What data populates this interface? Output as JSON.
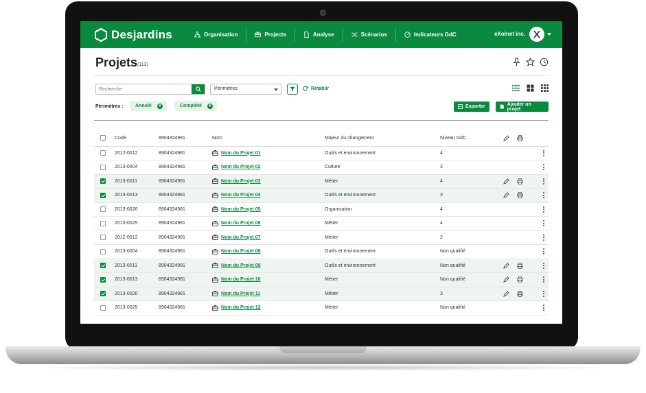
{
  "app": {
    "brand": "Desjardins",
    "nav": [
      {
        "label": "Organisation",
        "icon": "org-chart-icon"
      },
      {
        "label": "Projects",
        "icon": "briefcase-icon"
      },
      {
        "label": "Analyse",
        "icon": "document-icon"
      },
      {
        "label": "Scénarios",
        "icon": "shuffle-icon"
      },
      {
        "label": "Indicateurs GdC",
        "icon": "gauge-icon"
      }
    ],
    "user": "eXolnet inc.",
    "accent_color": "#0a8a3e"
  },
  "page": {
    "title": "Projets",
    "count": "(113)"
  },
  "filters": {
    "search_placeholder": "Recherche",
    "scope_select": "Périmètres",
    "reset_label": "Rétablir",
    "scope_label": "Périmètres :",
    "chips": [
      "Annulé",
      "Complété"
    ],
    "export_label": "Exporter",
    "add_label": "Ajouter un projet"
  },
  "table": {
    "headers": {
      "code": "Code",
      "number": "8904324981",
      "name": "Nom",
      "major": "Majeur du changement",
      "level": "Niveau GdC"
    },
    "rows": [
      {
        "checked": false,
        "code": "2012-0012",
        "number": "8904324981",
        "name": "Nom du Projet 01",
        "major": "Outils et environnement",
        "level": "4",
        "actions": false
      },
      {
        "checked": false,
        "code": "2013-0004",
        "number": "8904324981",
        "name": "Nom du Projet 02",
        "major": "Culture",
        "level": "3",
        "actions": false
      },
      {
        "checked": true,
        "code": "2013-0011",
        "number": "8904324981",
        "name": "Nom du Projet 03",
        "major": "Métier",
        "level": "4",
        "actions": true
      },
      {
        "checked": true,
        "code": "2013-0013",
        "number": "8904324981",
        "name": "Nom du Projet 04",
        "major": "Outils et environnement",
        "level": "3",
        "actions": true
      },
      {
        "checked": false,
        "code": "2013-0020",
        "number": "8904324981",
        "name": "Nom du Projet 05",
        "major": "Organisation",
        "level": "4",
        "actions": false
      },
      {
        "checked": false,
        "code": "2013-0025",
        "number": "8904324981",
        "name": "Nom du Projet 06",
        "major": "Métier",
        "level": "4",
        "actions": false
      },
      {
        "checked": false,
        "code": "2012-0012",
        "number": "8904324981",
        "name": "Nom du Projet 07",
        "major": "Métier",
        "level": "2",
        "actions": false
      },
      {
        "checked": false,
        "code": "2013-0004",
        "number": "8904324981",
        "name": "Nom du Projet 08",
        "major": "Outils et environnement",
        "level": "Non qualifié",
        "actions": false
      },
      {
        "checked": true,
        "code": "2013-0011",
        "number": "8904324981",
        "name": "Nom du Projet 09",
        "major": "Outils et environnement",
        "level": "Non qualifié",
        "actions": true
      },
      {
        "checked": true,
        "code": "2013-0013",
        "number": "8904324981",
        "name": "Nom du Projet 10",
        "major": "Métier",
        "level": "Non qualifié",
        "actions": true
      },
      {
        "checked": true,
        "code": "2013-0020",
        "number": "8904324981",
        "name": "Nom du Projet 11",
        "major": "Métier",
        "level": "3",
        "actions": true
      },
      {
        "checked": false,
        "code": "2013-0025",
        "number": "8904324981",
        "name": "Nom du Projet 12",
        "major": "Métier",
        "level": "Non qualifié",
        "actions": false
      }
    ]
  }
}
